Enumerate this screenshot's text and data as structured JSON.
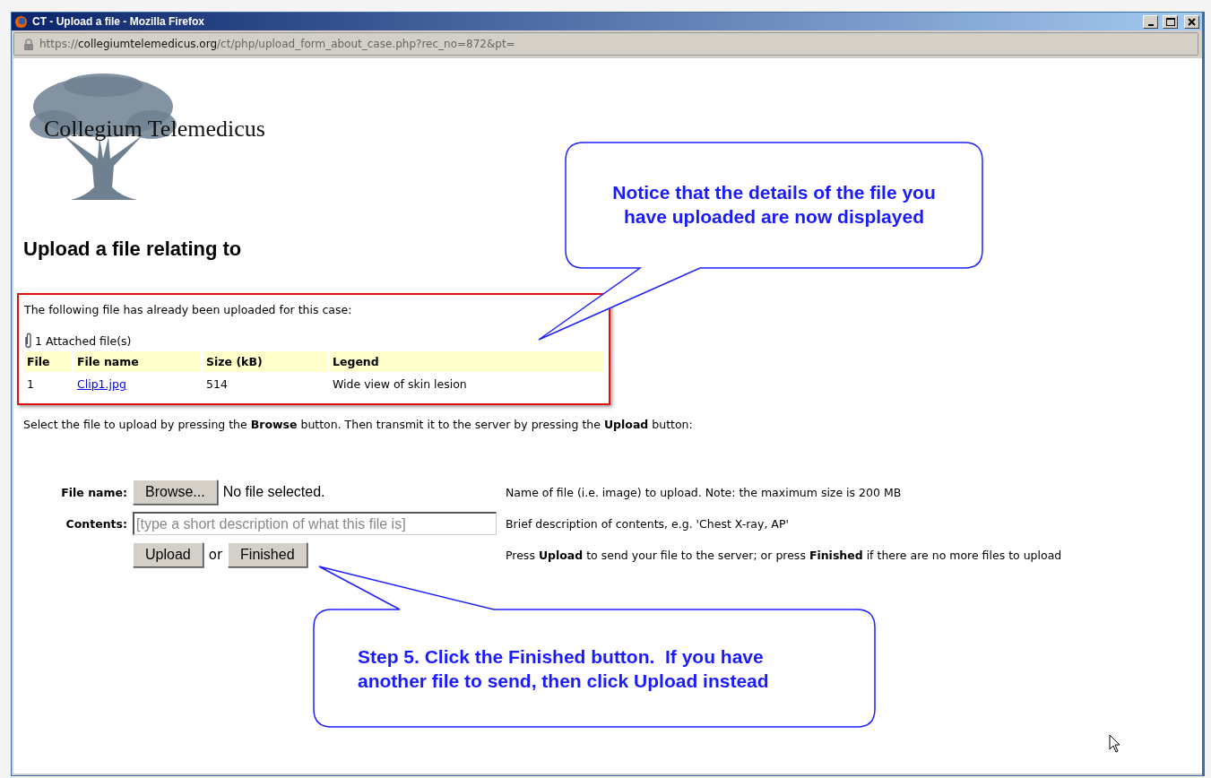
{
  "window": {
    "title": "CT - Upload a file - Mozilla Firefox",
    "address": {
      "scheme": "https://",
      "host": "collegiumtelemedicus.org",
      "path": "/ct/php/upload_form_about_case.php?rec_no=872&pt="
    }
  },
  "logo": {
    "text": "Collegium Telemedicus"
  },
  "heading": "Upload a file relating to",
  "uploaded_box": {
    "intro": "The following file has already been uploaded for this case:",
    "attached_count": "1 Attached file(s)",
    "columns": [
      "File",
      "File name",
      "Size (kB)",
      "Legend"
    ],
    "rows": [
      {
        "file": "1",
        "file_name": "Clip1.jpg",
        "size": "514",
        "legend": "Wide view of skin lesion"
      }
    ]
  },
  "instructions": "Select the file to upload by pressing the **Browse** button. Then transmit it to the server by pressing the **Upload** button:",
  "form": {
    "rows": [
      {
        "kind": "file",
        "label": "File name:",
        "button": "Browse...",
        "status": "No file selected.",
        "help": "Name of file (i.e. image) to upload. Note: the maximum size is 200 MB"
      },
      {
        "kind": "text",
        "label": "Contents:",
        "placeholder": "[type a short description of what this file is]",
        "help": "Brief description of contents, e.g. 'Chest X-ray, AP'"
      },
      {
        "kind": "actions",
        "buttons": [
          "Upload",
          "Finished"
        ],
        "separator": "or",
        "help": "Press **Upload** to send your file to the server; or press **Finished** if there are no more files to upload"
      }
    ]
  },
  "callouts": [
    {
      "text": "Notice that the details of the file you have uploaded are now displayed"
    },
    {
      "text": "Step 5. Click the Finished button.  If you have another file to send, then click Upload instead"
    }
  ]
}
